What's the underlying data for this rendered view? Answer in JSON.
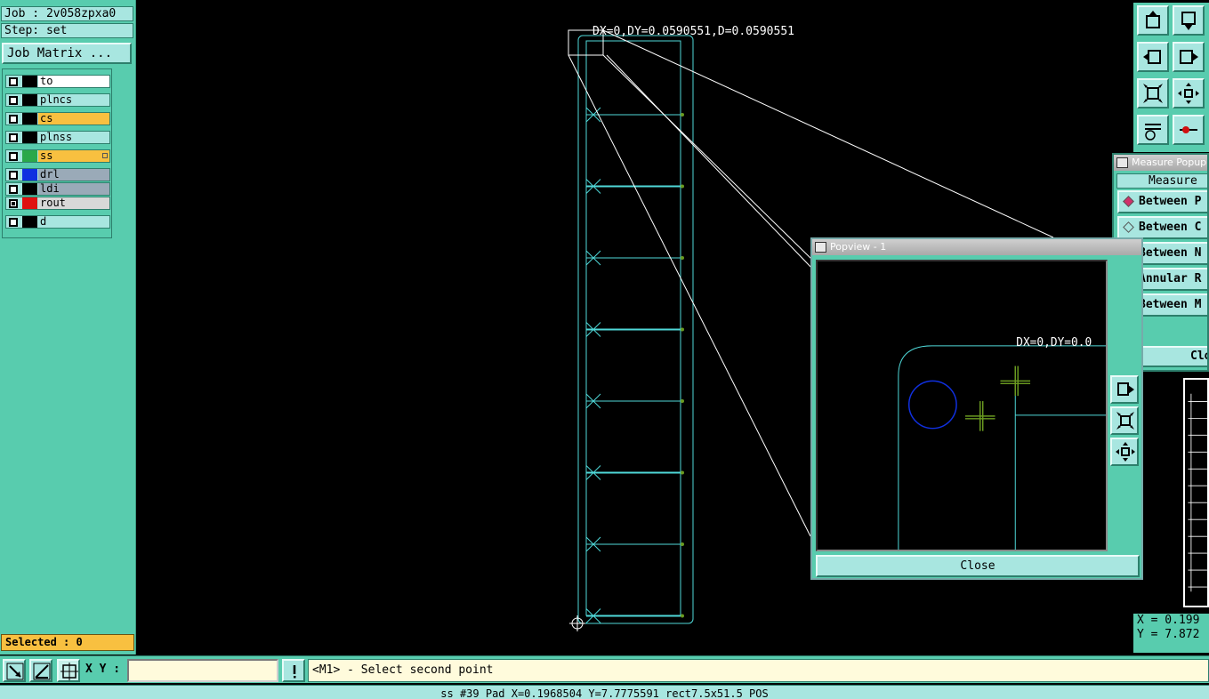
{
  "job": {
    "job_label": "Job : 2v058zpxa0",
    "step_label": "Step: set",
    "matrix_button": "Job Matrix ..."
  },
  "layers": [
    {
      "name": "to",
      "color": "#000000",
      "bg": "#ffffff",
      "checked": false
    },
    {
      "name": "plncs",
      "color": "#000000",
      "bg": "#a8e6e0",
      "checked": false
    },
    {
      "name": "cs",
      "color": "#000000",
      "bg": "#f8c040",
      "checked": false
    },
    {
      "name": "plnss",
      "color": "#000000",
      "bg": "#a8e6e0",
      "checked": false
    },
    {
      "name": "ss",
      "color": "#2aa84a",
      "bg": "#f8c040",
      "checked": false
    },
    {
      "name": "drl",
      "color": "#1030e0",
      "bg": "#9aaab8",
      "checked": false
    },
    {
      "name": "ldi",
      "color": "#000000",
      "bg": "#9aaab8",
      "checked": false
    },
    {
      "name": "rout",
      "color": "#e01010",
      "bg": "#d8d8d8",
      "checked": true
    },
    {
      "name": "d",
      "color": "#000000",
      "bg": "#a8e6e0",
      "checked": false
    }
  ],
  "selected_label": "Selected : 0",
  "measure_readout": "DX=0,DY=0.0590551,D=0.0590551",
  "popview": {
    "title": "Popview - 1",
    "readout": "DX=0,DY=0.0",
    "close_label": "Close"
  },
  "measure_popup": {
    "title": "Measure Popup",
    "heading": "Measure",
    "options": [
      {
        "label": "Between P",
        "selected": true
      },
      {
        "label": "Between C",
        "selected": false
      },
      {
        "label": "Between N",
        "selected": false
      },
      {
        "label": "Annular R",
        "selected": false
      },
      {
        "label": "Between M",
        "selected": false
      }
    ],
    "close_label": "Clos"
  },
  "coords": {
    "x": "X = 0.199",
    "y": "Y = 7.872"
  },
  "input": {
    "label": "X Y :",
    "value": ""
  },
  "prompt_message": "<M1> - Select second point",
  "status_line": "ss #39 Pad X=0.1968504 Y=7.7775591 rect7.5x51.5 POS"
}
